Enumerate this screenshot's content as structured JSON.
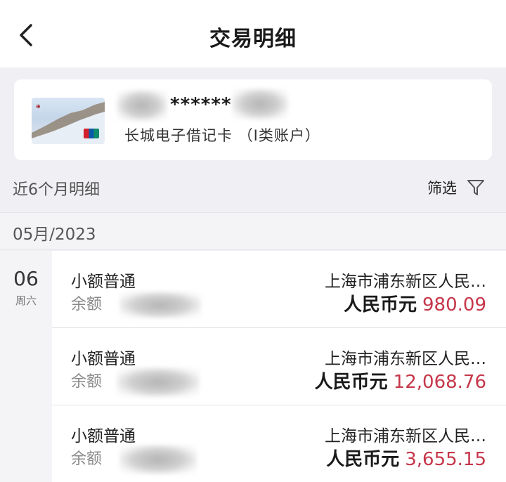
{
  "header": {
    "title": "交易明细",
    "back_icon": "chevron-left-icon"
  },
  "card": {
    "masked_number": "******",
    "name": "长城电子借记卡 （I类账户）"
  },
  "filter_bar": {
    "period_label": "近6个月明细",
    "filter_label": "筛选",
    "filter_icon": "funnel-icon"
  },
  "month_header": "05月/2023",
  "date": {
    "day": "06",
    "weekday": "周六"
  },
  "transactions": [
    {
      "type": "小额普通",
      "balance_label": "余额",
      "location": "上海市浦东新区人民…",
      "currency": "人民币元",
      "amount": "980.09"
    },
    {
      "type": "小额普通",
      "balance_label": "余额",
      "location": "上海市浦东新区人民…",
      "currency": "人民币元",
      "amount": "12,068.76"
    },
    {
      "type": "小额普通",
      "balance_label": "余额",
      "location": "上海市浦东新区人民…",
      "currency": "人民币元",
      "amount": "3,655.15"
    }
  ],
  "colors": {
    "amount": "#c6374a",
    "background": "#efeff4"
  }
}
